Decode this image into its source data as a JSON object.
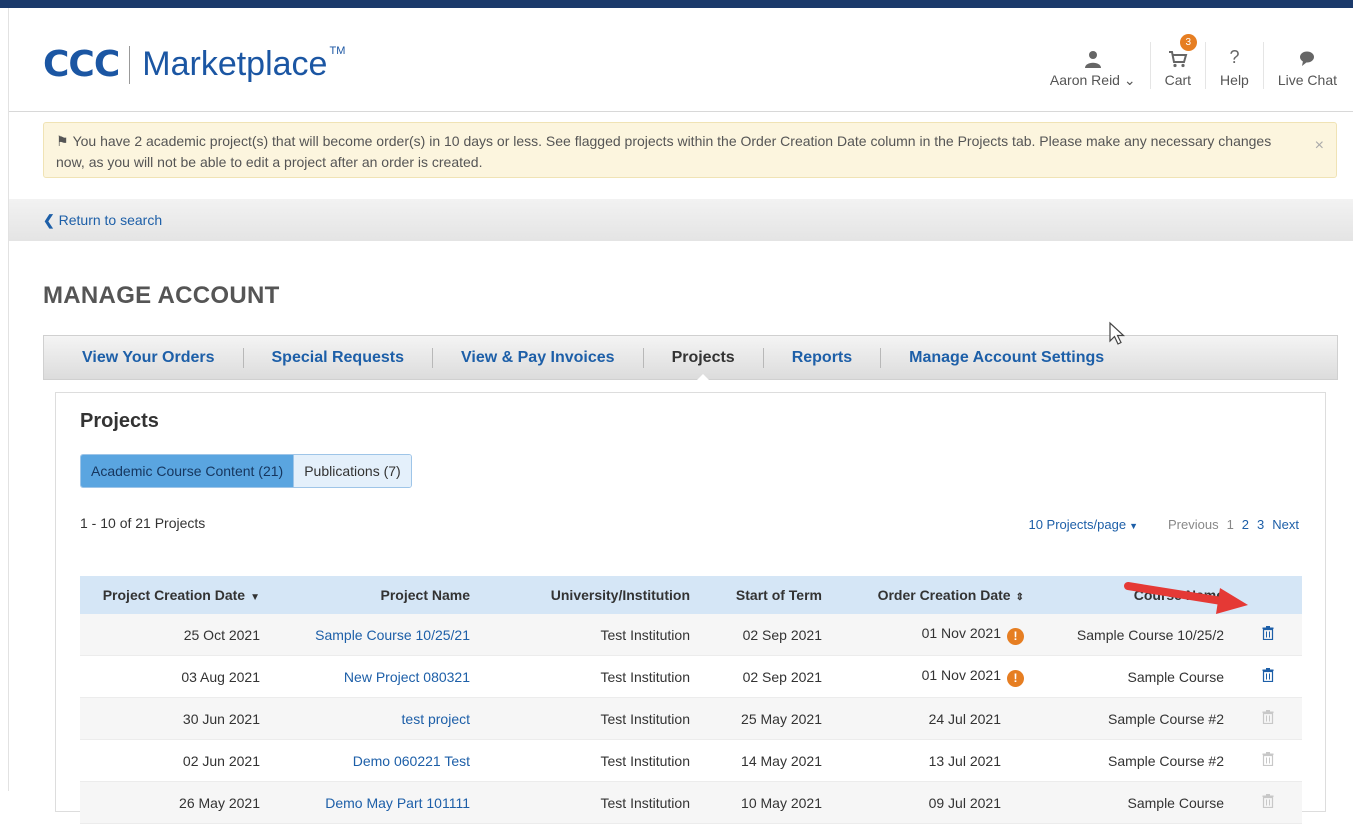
{
  "header": {
    "logo_mark": "CCC",
    "logo_text": "Marketplace",
    "logo_tm": "TM",
    "user_name": "Aaron Reid",
    "cart_label": "Cart",
    "cart_count": "3",
    "help_label": "Help",
    "help_icon": "?",
    "chat_label": "Live Chat"
  },
  "alert": {
    "message": "You have 2 academic project(s) that will become order(s) in 10 days or less. See flagged projects within the Order Creation Date column in the Projects tab. Please make any necessary changes now, as you will not be able to edit a project after an order is created.",
    "close": "×"
  },
  "nav": {
    "return_label": "Return to search"
  },
  "page": {
    "title": "MANAGE ACCOUNT"
  },
  "tabs": [
    {
      "label": "View Your Orders"
    },
    {
      "label": "Special Requests"
    },
    {
      "label": "View & Pay Invoices"
    },
    {
      "label": "Projects"
    },
    {
      "label": "Reports"
    },
    {
      "label": "Manage Account Settings"
    }
  ],
  "projects": {
    "title": "Projects",
    "segments": [
      {
        "label": "Academic Course Content (21)"
      },
      {
        "label": "Publications (7)"
      }
    ],
    "count_text": "1 - 10 of 21 Projects",
    "per_page": "10 Projects/page",
    "pager": {
      "previous": "Previous",
      "pages": [
        "1",
        "2",
        "3"
      ],
      "next": "Next"
    },
    "columns": [
      "Project Creation Date",
      "Project Name",
      "University/Institution",
      "Start of Term",
      "Order Creation Date",
      "Course Name"
    ],
    "sort_icons": {
      "desc": "▼",
      "both": "⇕"
    },
    "warn_icon": "!",
    "rows": [
      {
        "created": "25 Oct 2021",
        "name": "Sample Course 10/25/21",
        "institution": "Test Institution",
        "term_start": "02 Sep 2021",
        "order_date": "01 Nov 2021",
        "course": "Sample Course 10/25/2",
        "flagged": true,
        "deletable": true
      },
      {
        "created": "03 Aug 2021",
        "name": "New Project 080321",
        "institution": "Test Institution",
        "term_start": "02 Sep 2021",
        "order_date": "01 Nov 2021",
        "course": "Sample Course",
        "flagged": true,
        "deletable": true
      },
      {
        "created": "30 Jun 2021",
        "name": "test project",
        "institution": "Test Institution",
        "term_start": "25 May 2021",
        "order_date": "24 Jul 2021",
        "course": "Sample Course #2",
        "flagged": false,
        "deletable": false
      },
      {
        "created": "02 Jun 2021",
        "name": "Demo 060221 Test",
        "institution": "Test Institution",
        "term_start": "14 May 2021",
        "order_date": "13 Jul 2021",
        "course": "Sample Course #2",
        "flagged": false,
        "deletable": false
      },
      {
        "created": "26 May 2021",
        "name": "Demo May Part 101111",
        "institution": "Test Institution",
        "term_start": "10 May 2021",
        "order_date": "09 Jul 2021",
        "course": "Sample Course",
        "flagged": false,
        "deletable": false
      }
    ]
  },
  "colors": {
    "brand_blue": "#1b56a3",
    "link_blue": "#1d5fa8",
    "warn_orange": "#e67e22",
    "annotation_red": "#e53935",
    "trash_active": "#1d5fa8",
    "trash_disabled": "#c8c8c8"
  }
}
